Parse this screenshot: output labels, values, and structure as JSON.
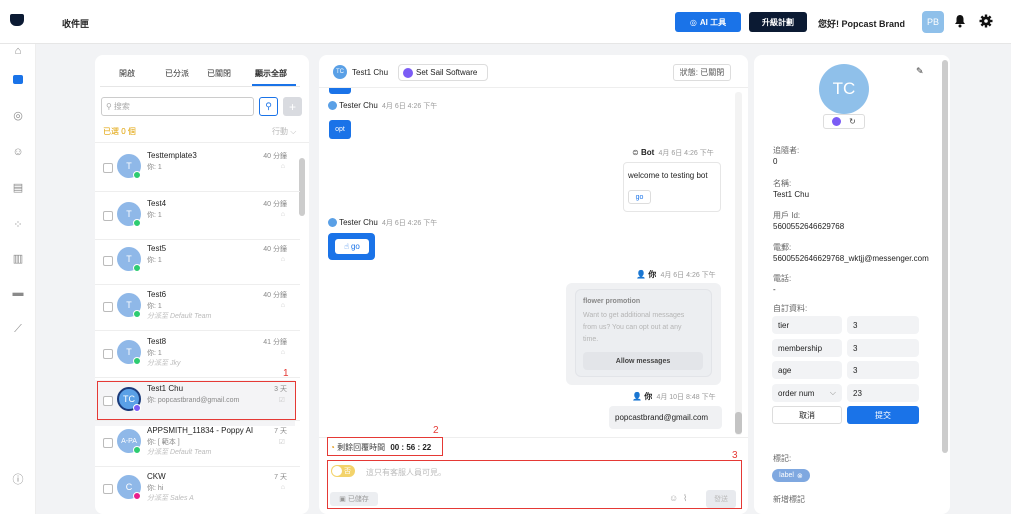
{
  "header": {
    "title": "收件匣",
    "ai_tools": "AI 工具",
    "upgrade": "升級計劃",
    "greeting": "您好! Popcast Brand",
    "avatar": "PB"
  },
  "left_panel": {
    "tabs": [
      "開啟",
      "已分派",
      "已關閉",
      "顯示全部"
    ],
    "search_placeholder": "搜索",
    "selected_count": "已選 0 個",
    "action": "行動",
    "conversations": [
      {
        "initial": "T",
        "name": "Testtemplate3",
        "message": "你: 1",
        "time": "40 分鐘",
        "assigned": ""
      },
      {
        "initial": "T",
        "name": "Test4",
        "message": "你: 1",
        "time": "40 分鐘",
        "assigned": ""
      },
      {
        "initial": "T",
        "name": "Test5",
        "message": "你: 1",
        "time": "40 分鐘",
        "assigned": ""
      },
      {
        "initial": "T",
        "name": "Test6",
        "message": "你: 1",
        "time": "40 分鐘",
        "assigned": "分派至 Default Team"
      },
      {
        "initial": "T",
        "name": "Test8",
        "message": "你: 1",
        "time": "41 分鐘",
        "assigned": "分派至 Jky"
      },
      {
        "initial": "TC",
        "name": "Test1 Chu",
        "message": "你: popcastbrand@gmail.com",
        "time": "3 天",
        "assigned": ""
      },
      {
        "initial": "A-PA",
        "name": "APPSMITH_11834 - Poppy AI",
        "message": "你: [ 範本 ]",
        "time": "7 天",
        "assigned": "分派至 Default Team"
      },
      {
        "initial": "C",
        "name": "CKW",
        "message": "你: hi",
        "time": "7 天",
        "assigned": "分派至 Sales A"
      }
    ]
  },
  "chat": {
    "contact_avatar": "TC",
    "contact_name": "Test1 Chu",
    "page_name": "Set Sail Software",
    "status": "狀態: 已關閉",
    "messages": {
      "opt_btn": "opt",
      "tester1_name": "Tester Chu",
      "tester1_time": "4月 6日 4:26 下午",
      "bot_name": "Bot",
      "bot_time": "4月 6日 4:26 下午",
      "bot_text": "welcome to testing bot",
      "bot_btn": "go",
      "tester2_name": "Tester Chu",
      "tester2_time": "4月 6日 4:26 下午",
      "tester2_btn": "go",
      "you1_name": "你",
      "you1_time": "4月 6日 4:26 下午",
      "promo_title": "flower promotion",
      "promo_text": "Want to get additional messages from us? You can opt out at any time.",
      "promo_btn": "Allow messages",
      "you2_name": "你",
      "you2_time": "4月 10日 8:48 下午",
      "you2_text": "popcastbrand@gmail.com"
    },
    "remaining_label": "剩餘回覆時間",
    "remaining_time": "00 : 56 : 22",
    "toggle_label": "否",
    "input_placeholder": "這只有客服人員可見。",
    "saved": "已儲存",
    "send": "發送"
  },
  "profile": {
    "avatar": "TC",
    "followers_label": "追隨者:",
    "followers": "0",
    "name_label": "名稱:",
    "name": "Test1 Chu",
    "userid_label": "用戶 Id:",
    "userid": "5600552646629768",
    "phone_label": "電郵:",
    "phone": "5600552646629768_wktjj@messenger.com",
    "email_label": "電話:",
    "email": "-",
    "custom_label": "自訂資料:",
    "custom_fields": [
      {
        "key": "tier",
        "value": "3"
      },
      {
        "key": "membership",
        "value": "3"
      },
      {
        "key": "age",
        "value": "3"
      },
      {
        "key": "order num",
        "value": "23"
      }
    ],
    "cancel": "取消",
    "submit": "提交",
    "tags_label": "標記:",
    "tag": "label",
    "add_tag": "新增標記"
  },
  "annotations": [
    "1",
    "2",
    "3"
  ],
  "colors": {
    "primary": "#1a73e8",
    "dark": "#0b1a33",
    "red": "#e53935",
    "messenger": "#7b5cf5"
  }
}
